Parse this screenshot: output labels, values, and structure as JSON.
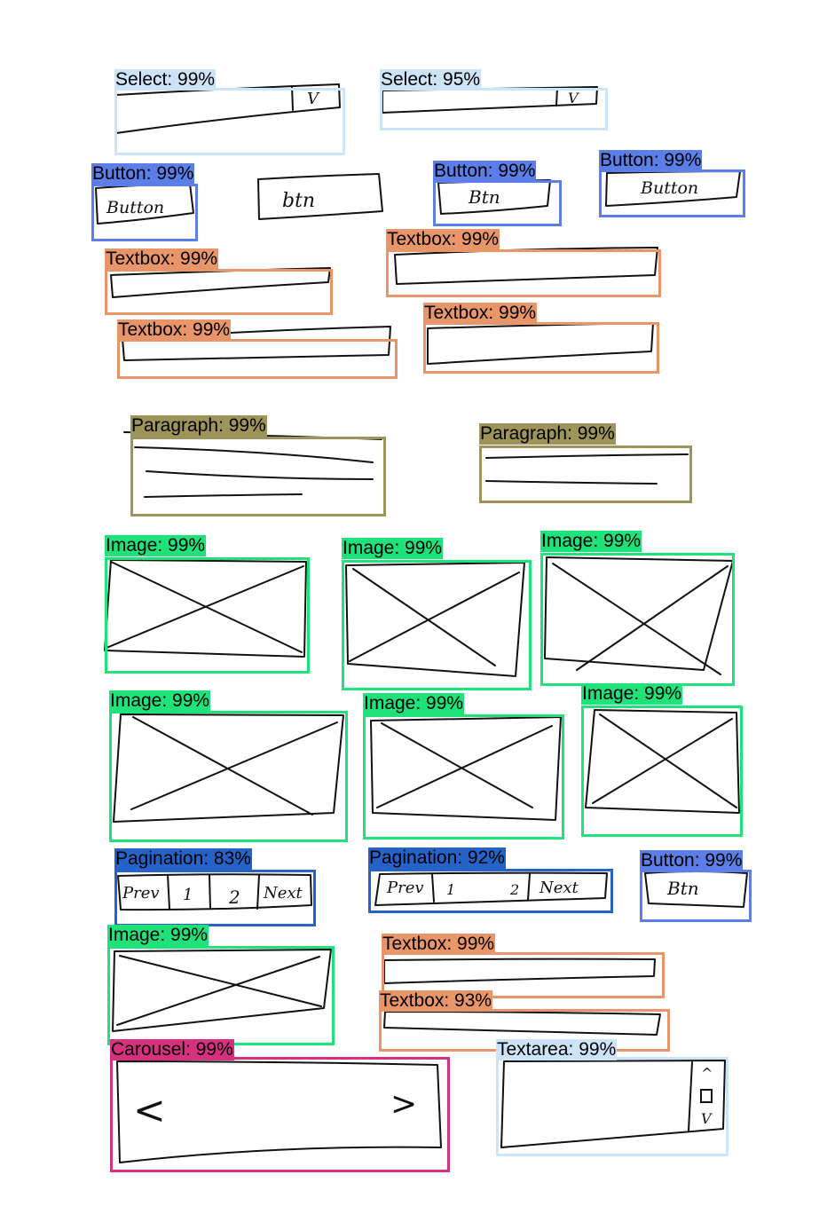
{
  "colors": {
    "select": "#cde3f7",
    "button": "#5b7ee8",
    "textbox": "#e8956a",
    "paragraph": "#9c9459",
    "image": "#1fe27a",
    "pagination": "#2563c9",
    "carousel": "#d6307e",
    "textarea": "#cde3f7"
  },
  "detections": [
    {
      "label": "Select: 99%",
      "class": "select"
    },
    {
      "label": "Select: 95%",
      "class": "select"
    },
    {
      "label": "Button: 99%",
      "class": "button"
    },
    {
      "label": "Button: 99%",
      "class": "button"
    },
    {
      "label": "Button: 99%",
      "class": "button"
    },
    {
      "label": "Textbox: 99%",
      "class": "textbox"
    },
    {
      "label": "Textbox: 99%",
      "class": "textbox"
    },
    {
      "label": "Textbox: 99%",
      "class": "textbox"
    },
    {
      "label": "Textbox: 99%",
      "class": "textbox"
    },
    {
      "label": "Paragraph: 99%",
      "class": "paragraph"
    },
    {
      "label": "Paragraph: 99%",
      "class": "paragraph"
    },
    {
      "label": "Image: 99%",
      "class": "image"
    },
    {
      "label": "Image: 99%",
      "class": "image"
    },
    {
      "label": "Image: 99%",
      "class": "image"
    },
    {
      "label": "Image: 99%",
      "class": "image"
    },
    {
      "label": "Image: 99%",
      "class": "image"
    },
    {
      "label": "Image: 99%",
      "class": "image"
    },
    {
      "label": "Pagination: 83%",
      "class": "pagination"
    },
    {
      "label": "Pagination: 92%",
      "class": "pagination"
    },
    {
      "label": "Button: 99%",
      "class": "button"
    },
    {
      "label": "Image: 99%",
      "class": "image"
    },
    {
      "label": "Textbox: 99%",
      "class": "textbox"
    },
    {
      "label": "Textbox: 93%",
      "class": "textbox"
    },
    {
      "label": "Carousel: 99%",
      "class": "carousel"
    },
    {
      "label": "Textarea: 99%",
      "class": "textarea"
    }
  ],
  "sketch_text": {
    "select_arrow_1": "V",
    "select_arrow_2": "V",
    "button_1": "Button",
    "button_unlabeled": "btn",
    "button_2": "Btn",
    "button_3": "Button",
    "pagination_1": [
      "Prev",
      "1",
      "2",
      "Next"
    ],
    "pagination_2": [
      "Prev",
      "1",
      "2",
      "Next"
    ],
    "button_4": "Btn",
    "carousel_left": "<",
    "carousel_right": ">",
    "scroll_up": "^",
    "scroll_down": "V"
  }
}
